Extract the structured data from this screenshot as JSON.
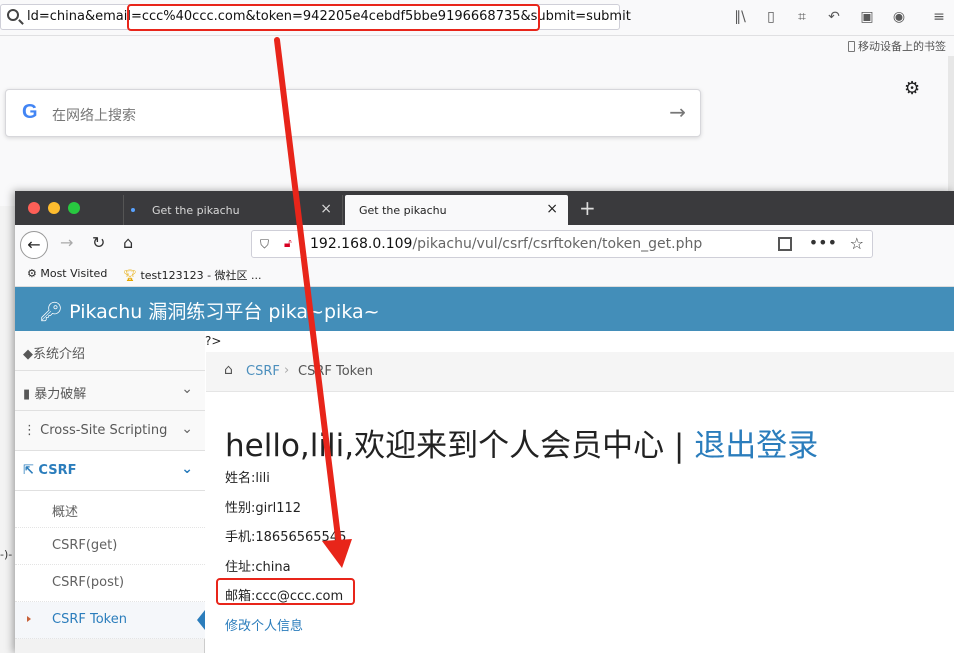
{
  "bg_browser": {
    "url_text": "ld=china&email=ccc%40ccc.com&token=942205e4cebdf5bbe9196668735&submit=submit",
    "mobile_bookmarks": "移动设备上的书签",
    "google_logo": "G",
    "search_placeholder": "在网络上搜索",
    "left_fragment": "-)-",
    "toolbar_icons": [
      "library-icon",
      "sidebar-icon",
      "crop-icon",
      "undo-icon",
      "translate-icon",
      "account-icon",
      "menu-icon"
    ]
  },
  "window": {
    "tabs": [
      {
        "title": "Get the pikachu",
        "close": "×"
      },
      {
        "title": "Get the pikachu",
        "close": "×"
      }
    ],
    "new_tab": "+",
    "url_host": "192.168.0.109",
    "url_path": "/pikachu/vul/csrf/csrftoken/token_get.php",
    "bookmarks": [
      {
        "label": "Most Visited"
      },
      {
        "label": "test123123 - 微社区 ..."
      }
    ]
  },
  "site": {
    "title": "Pikachu 漏洞练习平台 pika~pika~",
    "stray_text": "?>",
    "sidebar": {
      "items": [
        {
          "label": "系统介绍"
        },
        {
          "label": "暴力破解",
          "chevron": "⌄"
        },
        {
          "label": "Cross-Site Scripting",
          "chevron": "⌄"
        },
        {
          "label": "CSRF",
          "chevron": "⌄"
        }
      ],
      "subitems": [
        {
          "label": "概述"
        },
        {
          "label": "CSRF(get)"
        },
        {
          "label": "CSRF(post)"
        },
        {
          "label": "CSRF Token"
        }
      ]
    },
    "breadcrumb": {
      "section": "CSRF",
      "separator": "›",
      "current": "CSRF Token"
    },
    "welcome": "hello,lili,欢迎来到个人会员中心 | ",
    "logout": "退出登录",
    "info": [
      "姓名:lili",
      "性别:girl112",
      "手机:18656565545",
      "住址:china",
      "邮箱:ccc@ccc.com"
    ],
    "edit_link": "修改个人信息"
  },
  "annotation": {
    "color": "#e8251a"
  }
}
